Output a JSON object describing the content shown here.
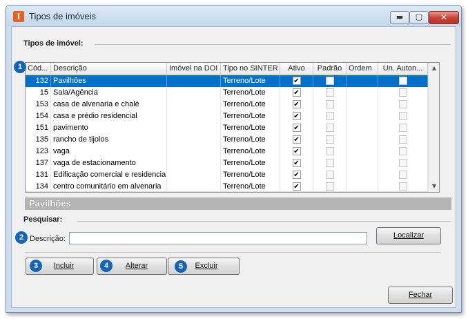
{
  "window": {
    "title": "Tipos de imóveis",
    "icon_letter": "I",
    "controls": {
      "minimize": "▬",
      "maximize": "▢",
      "close": "✕"
    }
  },
  "group": {
    "label": "Tipos de imóvel:"
  },
  "badges": [
    "1",
    "2",
    "3",
    "4",
    "5"
  ],
  "table": {
    "columns": [
      "Cód...",
      "Descrição",
      "Imóvel na DOI",
      "Tipo no SINTER",
      "Ativo",
      "Padrão",
      "Ordem",
      "Un. Auton..."
    ],
    "rows": [
      {
        "code": "132",
        "description": "Pavilhões",
        "doi": "",
        "sinter": "Terreno/Lote",
        "ativo": true,
        "padrao": false,
        "ordem": "",
        "un_auton": false,
        "selected": true
      },
      {
        "code": "15",
        "description": "Sala/Agência",
        "doi": "",
        "sinter": "Terreno/Lote",
        "ativo": true,
        "padrao": false,
        "ordem": "",
        "un_auton": false,
        "selected": false
      },
      {
        "code": "153",
        "description": "casa de alvenaria e chalé",
        "doi": "",
        "sinter": "Terreno/Lote",
        "ativo": true,
        "padrao": false,
        "ordem": "",
        "un_auton": false,
        "selected": false
      },
      {
        "code": "154",
        "description": "casa e prédio residencial",
        "doi": "",
        "sinter": "Terreno/Lote",
        "ativo": true,
        "padrao": false,
        "ordem": "",
        "un_auton": false,
        "selected": false
      },
      {
        "code": "151",
        "description": "pavimento",
        "doi": "",
        "sinter": "Terreno/Lote",
        "ativo": true,
        "padrao": false,
        "ordem": "",
        "un_auton": false,
        "selected": false
      },
      {
        "code": "135",
        "description": "rancho de tijolos",
        "doi": "",
        "sinter": "Terreno/Lote",
        "ativo": true,
        "padrao": false,
        "ordem": "",
        "un_auton": false,
        "selected": false
      },
      {
        "code": "123",
        "description": "vaga",
        "doi": "",
        "sinter": "Terreno/Lote",
        "ativo": true,
        "padrao": false,
        "ordem": "",
        "un_auton": false,
        "selected": false
      },
      {
        "code": "137",
        "description": "vaga de estacionamento",
        "doi": "",
        "sinter": "Terreno/Lote",
        "ativo": true,
        "padrao": false,
        "ordem": "",
        "un_auton": false,
        "selected": false
      },
      {
        "code": "131",
        "description": "Edificação comercial e residencial",
        "doi": "",
        "sinter": "Terreno/Lote",
        "ativo": true,
        "padrao": false,
        "ordem": "",
        "un_auton": false,
        "selected": false
      },
      {
        "code": "134",
        "description": "centro comunitário em alvenaria",
        "doi": "",
        "sinter": "Terreno/Lote",
        "ativo": true,
        "padrao": false,
        "ordem": "",
        "un_auton": false,
        "selected": false
      }
    ],
    "scroll_up": "▲",
    "scroll_down": "▼"
  },
  "detail": {
    "title": "Pavilhões"
  },
  "search": {
    "group_label": "Pesquisar:",
    "field_label": "Descrição:",
    "value": "",
    "button_label": "Localizar"
  },
  "actions": {
    "include": "Incluir",
    "edit": "Alterar",
    "delete": "Excluir",
    "close": "Fechar"
  },
  "colors": {
    "selection": "#0070c9",
    "badge": "#1565b6",
    "detail_bar": "#b4b4b4"
  }
}
